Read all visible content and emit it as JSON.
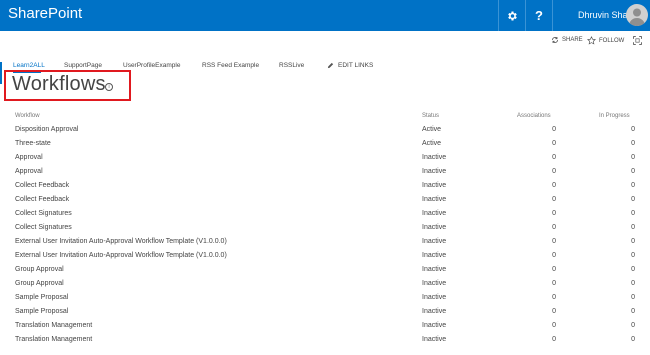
{
  "suitebar": {
    "brand": "SharePoint",
    "help_label": "?",
    "user_name": "Dhruvin Shah"
  },
  "actions": {
    "share": "SHARE",
    "follow": "FOLLOW"
  },
  "nav": {
    "items": [
      "Learn2ALL",
      "SupportPage",
      "UserProfileExample",
      "RSS Feed Example",
      "RSSLive"
    ],
    "edit_links": "EDIT LINKS"
  },
  "page": {
    "title": "Workflows",
    "info_glyph": "i"
  },
  "table": {
    "headers": {
      "workflow": "Workflow",
      "status": "Status",
      "associations": "Associations",
      "in_progress": "In Progress"
    },
    "rows": [
      {
        "name": "Disposition Approval",
        "status": "Active",
        "associations": "0",
        "in_progress": "0"
      },
      {
        "name": "Three-state",
        "status": "Active",
        "associations": "0",
        "in_progress": "0"
      },
      {
        "name": "Approval",
        "status": "Inactive",
        "associations": "0",
        "in_progress": "0"
      },
      {
        "name": "Approval",
        "status": "Inactive",
        "associations": "0",
        "in_progress": "0"
      },
      {
        "name": "Collect Feedback",
        "status": "Inactive",
        "associations": "0",
        "in_progress": "0"
      },
      {
        "name": "Collect Feedback",
        "status": "Inactive",
        "associations": "0",
        "in_progress": "0"
      },
      {
        "name": "Collect Signatures",
        "status": "Inactive",
        "associations": "0",
        "in_progress": "0"
      },
      {
        "name": "Collect Signatures",
        "status": "Inactive",
        "associations": "0",
        "in_progress": "0"
      },
      {
        "name": "External User Invitation Auto-Approval Workflow Template (V1.0.0.0)",
        "status": "Inactive",
        "associations": "0",
        "in_progress": "0"
      },
      {
        "name": "External User Invitation Auto-Approval Workflow Template (V1.0.0.0)",
        "status": "Inactive",
        "associations": "0",
        "in_progress": "0"
      },
      {
        "name": "Group Approval",
        "status": "Inactive",
        "associations": "0",
        "in_progress": "0"
      },
      {
        "name": "Group Approval",
        "status": "Inactive",
        "associations": "0",
        "in_progress": "0"
      },
      {
        "name": "Sample Proposal",
        "status": "Inactive",
        "associations": "0",
        "in_progress": "0"
      },
      {
        "name": "Sample Proposal",
        "status": "Inactive",
        "associations": "0",
        "in_progress": "0"
      },
      {
        "name": "Translation Management",
        "status": "Inactive",
        "associations": "0",
        "in_progress": "0"
      },
      {
        "name": "Translation Management",
        "status": "Inactive",
        "associations": "0",
        "in_progress": "0"
      }
    ]
  },
  "colors": {
    "suitebar": "#0072c6",
    "accent": "#0072c6",
    "highlight_box": "#e0191f"
  },
  "icons": [
    "gear-icon",
    "help-icon",
    "avatar",
    "share-icon",
    "follow-star-icon",
    "focus-icon",
    "edit-pencil-icon",
    "info-icon"
  ]
}
